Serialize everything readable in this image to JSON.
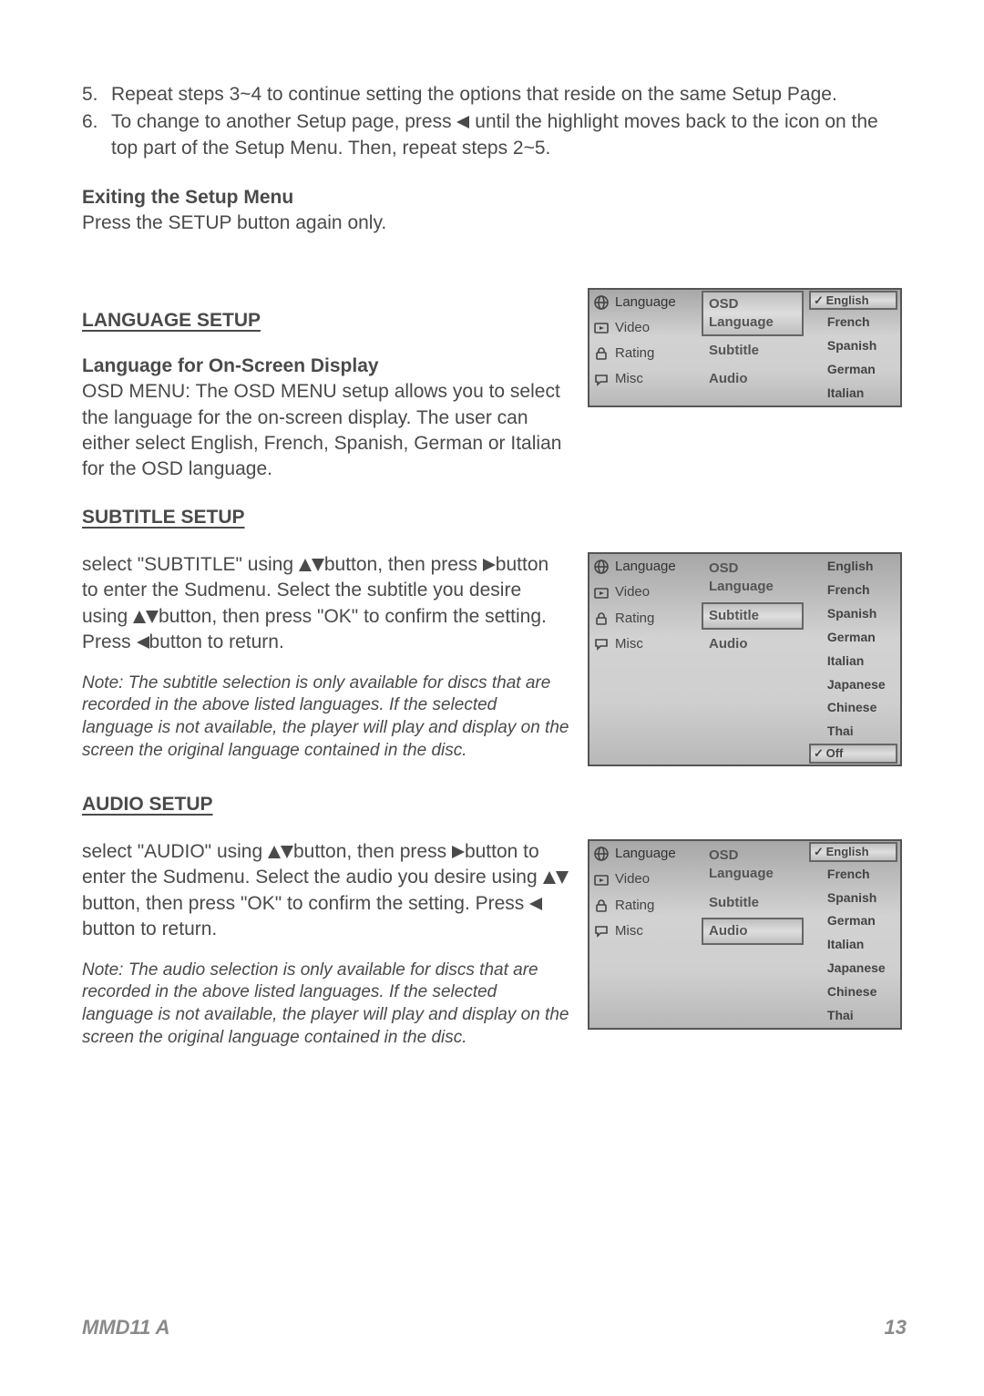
{
  "steps": {
    "s5": {
      "num": "5.",
      "text": "Repeat steps 3~4 to continue setting the options that reside on the same Setup Page."
    },
    "s6": {
      "num": "6.",
      "pre": "To change to another Setup page, press ",
      "post": " until the highlight moves back to the icon on the top part of the Setup Menu. Then, repeat steps 2~5."
    }
  },
  "exit": {
    "heading": "Exiting the Setup Menu",
    "text": "Press the SETUP button again only."
  },
  "lang": {
    "heading": "LANGUAGE SETUP",
    "sub": "Language for On-Screen Display",
    "para": "OSD MENU: The OSD MENU setup allows you to select the language for the on-screen display. The user can either select English, French, Spanish, German or Italian for the OSD language."
  },
  "subtitle": {
    "heading": "SUBTITLE SETUP",
    "p1a": "select \"SUBTITLE\" using ",
    "p1b": "button, then press ",
    "p1c": "button to enter the Sudmenu. Select the subtitle you desire using ",
    "p1d": "button, then press \"OK\" to confirm the setting. Press ",
    "p1e": "button to return.",
    "note": "Note: The subtitle selection is only available for discs that are recorded in the above listed languages. If the selected language is not available, the player will play and display on the screen the original language contained in the disc."
  },
  "audio": {
    "heading": "AUDIO SETUP",
    "p1a": "select \"AUDIO\" using ",
    "p1b": "button, then press ",
    "p1c": "button to enter the Sudmenu. Select the audio you desire using ",
    "p1d": "button, then press \"OK\" to confirm the setting. Press ",
    "p1e": "button to return.",
    "note": "Note: The audio selection is only available for discs that are recorded in the above listed languages. If the selected language is not available, the player will play and display on the screen the original language contained in the disc."
  },
  "menuCommon": {
    "sidebar": [
      "Language",
      "Video",
      "Rating",
      "Misc"
    ],
    "colB": [
      "OSD Language",
      "Subtitle",
      "Audio"
    ]
  },
  "menus": {
    "m1": {
      "highlightA": 0,
      "highlightB": 0,
      "opts": [
        "English",
        "French",
        "Spanish",
        "German",
        "Italian"
      ],
      "check": 0,
      "hlopt": 0
    },
    "m2": {
      "highlightA": 0,
      "highlightB": 1,
      "opts": [
        "English",
        "French",
        "Spanish",
        "German",
        "Italian",
        "Japanese",
        "Chinese",
        "Thai",
        "Off"
      ],
      "check": 8,
      "hlopt": 8
    },
    "m3": {
      "highlightA": 0,
      "highlightB": 2,
      "opts": [
        "English",
        "French",
        "Spanish",
        "German",
        "Italian",
        "Japanese",
        "Chinese",
        "Thai"
      ],
      "check": 0,
      "hlopt": 0
    }
  },
  "footer": {
    "model": "MMD11 A",
    "page": "13"
  }
}
